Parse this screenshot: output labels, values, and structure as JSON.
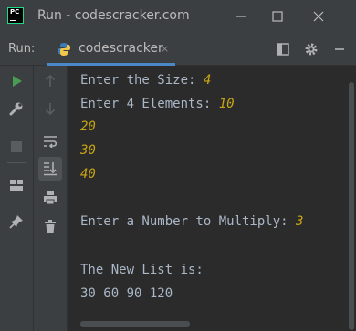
{
  "window": {
    "title": "Run - codescracker.com",
    "logo_text": "PC"
  },
  "tool_window": {
    "label": "Run:",
    "tab": {
      "label": "codescracker",
      "icon": "python-icon",
      "close": "×"
    }
  },
  "console": {
    "lines": [
      {
        "text": "Enter the Size: ",
        "input": "4"
      },
      {
        "text": "Enter 4 Elements: ",
        "input": "10"
      },
      {
        "text": "",
        "input": "20"
      },
      {
        "text": "",
        "input": "30"
      },
      {
        "text": "",
        "input": "40"
      },
      {
        "text": "",
        "input": ""
      },
      {
        "text": "Enter a Number to Multiply: ",
        "input": "3"
      },
      {
        "text": "",
        "input": ""
      },
      {
        "text": "The New List is:",
        "input": ""
      },
      {
        "text": "30 60 90 120",
        "input": ""
      }
    ]
  },
  "colors": {
    "console_text": "#a9b7c6",
    "user_input": "#c8a515",
    "run_green": "#499c54",
    "accent": "#4a88c7"
  },
  "icons": {
    "titlebar": [
      "minimize-icon",
      "maximize-icon",
      "close-icon"
    ],
    "toolbar_right": [
      "layout-icon",
      "gear-icon",
      "hide-icon"
    ],
    "left_gutter": [
      "rerun-icon",
      "wrench-icon",
      "stop-icon",
      "layout-icon",
      "pin-icon"
    ],
    "second_gutter": [
      "up-arrow-icon",
      "down-arrow-icon",
      "soft-wrap-icon",
      "scroll-to-end-icon",
      "print-icon",
      "trash-icon"
    ]
  }
}
